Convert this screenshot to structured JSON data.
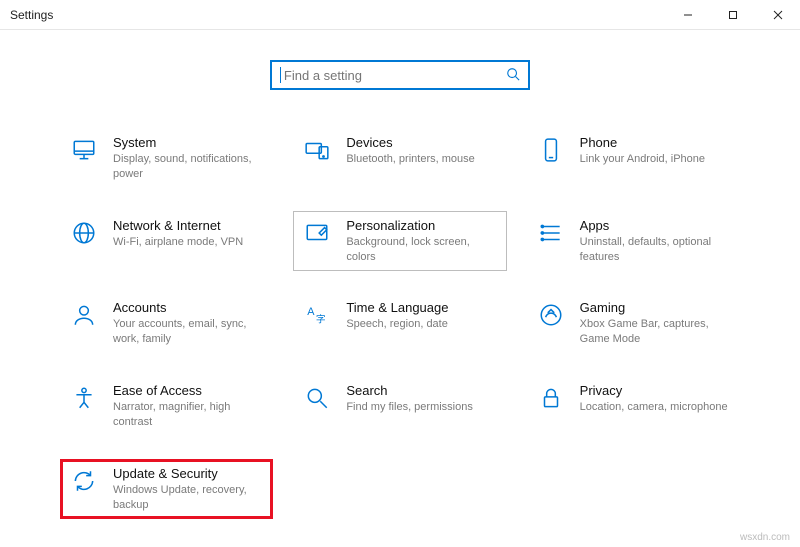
{
  "window": {
    "title": "Settings"
  },
  "search": {
    "placeholder": "Find a setting"
  },
  "tiles": {
    "system": {
      "name": "System",
      "desc": "Display, sound, notifications, power"
    },
    "devices": {
      "name": "Devices",
      "desc": "Bluetooth, printers, mouse"
    },
    "phone": {
      "name": "Phone",
      "desc": "Link your Android, iPhone"
    },
    "network": {
      "name": "Network & Internet",
      "desc": "Wi-Fi, airplane mode, VPN"
    },
    "personalization": {
      "name": "Personalization",
      "desc": "Background, lock screen, colors"
    },
    "apps": {
      "name": "Apps",
      "desc": "Uninstall, defaults, optional features"
    },
    "accounts": {
      "name": "Accounts",
      "desc": "Your accounts, email, sync, work, family"
    },
    "time": {
      "name": "Time & Language",
      "desc": "Speech, region, date"
    },
    "gaming": {
      "name": "Gaming",
      "desc": "Xbox Game Bar, captures, Game Mode"
    },
    "ease": {
      "name": "Ease of Access",
      "desc": "Narrator, magnifier, high contrast"
    },
    "search_tile": {
      "name": "Search",
      "desc": "Find my files, permissions"
    },
    "privacy": {
      "name": "Privacy",
      "desc": "Location, camera, microphone"
    },
    "update": {
      "name": "Update & Security",
      "desc": "Windows Update, recovery, backup"
    }
  },
  "watermark": "wsxdn.com"
}
